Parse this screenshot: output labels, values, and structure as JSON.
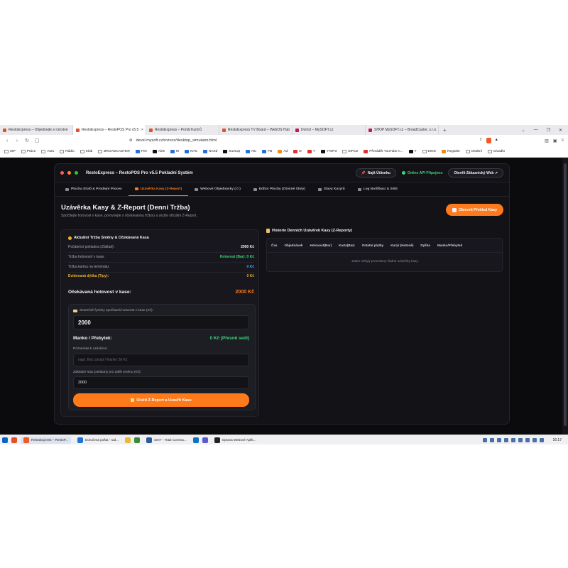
{
  "browser": {
    "tabs": [
      {
        "label": "RestoExpress – Objednejte si čerstvé"
      },
      {
        "label": "RestoExpress – RestoPOS Pro v5.5",
        "active": true
      },
      {
        "label": "RestoExpress – Portál Kurýrů"
      },
      {
        "label": "RestoExpress TV Board – WebOS Hub"
      },
      {
        "label": "DomU – MySOFT.cz"
      },
      {
        "label": "SHOP MySOFT.cz – BroadCaster, s.r.o."
      }
    ],
    "new_tab": "+",
    "url": "devel.mysoft.cz/rozvoz/desktop_simulator.html",
    "bookmarks": [
      "ISP",
      "Práce",
      "Auto",
      "Rádio",
      "Klub",
      "BROADCASTER",
      "FIO",
      "AirB",
      "M",
      "NAS",
      "NASd",
      "SumUp",
      "NC",
      "FB",
      "Ad",
      "D",
      "Y",
      "Y-MP3",
      "SIPCZ",
      "Převádět YouTube n...",
      "T",
      "EIOS",
      "Regiolet",
      "Osobní",
      "Divadlo"
    ]
  },
  "app": {
    "title": "RestoExpress – RestoPOS Pro v5.5 Pokladní Systém",
    "header": {
      "find_account": "Najít Účtenku",
      "online_status": "Online API Připojeno",
      "open_web": "Otevřít Zákaznický Web ↗"
    },
    "tabs": [
      {
        "label": "Plocha Stolů & Prodejní Proces"
      },
      {
        "label": "Uzávěrka Kasy (Z-Report)",
        "active": true
      },
      {
        "label": "Webové Objednávky ( 0 )"
      },
      {
        "label": "Editor Plochy (Otočné Stoly)"
      },
      {
        "label": "Stavy Kurýrů"
      },
      {
        "label": "Log Notifikací & SMS"
      }
    ],
    "page": {
      "title": "Uzávěrka Kasy & Z-Report (Denní Tržba)",
      "subtitle": "Spočítejte hotovost v kase, porovnejte s očekávanou tržbou a uložte oficiální Z-Report.",
      "refresh_button": "Obnovit Přehled Kasy"
    },
    "summary": {
      "title": "Aktuální Tržba Směny & Očekávaná Kasa",
      "rows": [
        {
          "label": "Počáteční pokladna (Základ):",
          "value": "2000 Kč",
          "color": "#f4f4f6"
        },
        {
          "label": "Tržba hotovostí v kase:",
          "value": "Hotovost (Bar): 0 Kč",
          "color": "#3fd47a"
        },
        {
          "label": "Tržba kartou na terminálu:",
          "value": "0 Kč",
          "color": "#4ea1ff"
        },
        {
          "label": "Evidovaná dýška (Tipy):",
          "value": "0 Kč",
          "color": "#f0b323"
        }
      ],
      "expected_label": "Očekávaná hotovost v kase:",
      "expected_value": "2000 Kč"
    },
    "form": {
      "counted_label": "Skutečně fyzicky spočítaná hotovost v kase (Kč):",
      "counted_value": "2000",
      "manko_label": "Manko / Přebytek:",
      "manko_value": "0 Kč (Přesně sedí)",
      "note_label": "Poznámka k uzávěrce:",
      "note_placeholder": "např. Bez závad / Manko 50 Kč",
      "base_label": "Základní stav pokladny pro další směnu (Kč):",
      "base_value": "2000",
      "save_button": "Uložit Z-Report a Uzavřít Kasu"
    },
    "history": {
      "title": "Historie Denních Uzávěrek Kasy (Z-Reporty)",
      "columns": [
        "Čas",
        "Objednávek",
        "Hotovost(Bar)",
        "Karta(Bar)",
        "Ostatní platby",
        "Kurýr (Hotově)",
        "Dýška",
        "Manko/Přebytek"
      ],
      "empty_text": "Zatím nebyly provedeny žádné uzávěrky kasy."
    }
  },
  "taskbar": {
    "items": [
      {
        "label": "RestoExpress – RestoP...",
        "active": true
      },
      {
        "label": "Doručená pošta - rad..."
      },
      {
        "label": "oem* - Total Comma..."
      },
      {
        "label": "Oprava Webové Aplik..."
      }
    ],
    "clock": "16:17"
  },
  "colors": {
    "accent": "#ff7a1a",
    "success": "#3fd47a",
    "card": "#4ea1ff",
    "tips": "#f0b323"
  }
}
